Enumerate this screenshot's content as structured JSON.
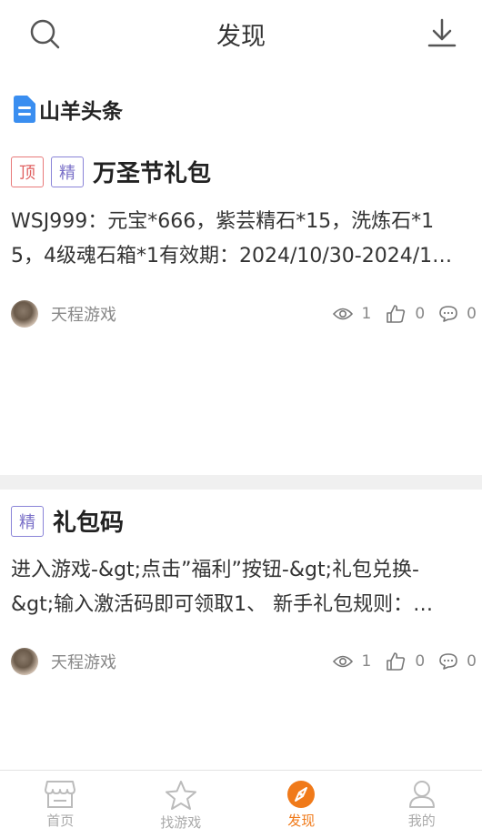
{
  "header": {
    "title": "发现",
    "search_icon": "search-icon",
    "download_icon": "download-icon"
  },
  "section": {
    "label": "山羊头条",
    "icon": "document-icon",
    "icon_color": "#3a8ef0"
  },
  "posts": [
    {
      "tags": [
        "顶",
        "精"
      ],
      "title": "万圣节礼包",
      "desc_line1": "WSJ999：元宝*666，紫芸精石*15，洗炼石*1",
      "desc_line2": "5，4级魂石箱*1有效期：2024/10/30-2024/1…",
      "author": "天程游戏",
      "views": "1",
      "likes": "0",
      "comments": "0"
    },
    {
      "tags": [
        "精"
      ],
      "title": "礼包码",
      "desc_line1": "进入游戏-&gt;点击”福利”按钮-&gt;礼包兑换-",
      "desc_line2": "&gt;输入激活码即可领取1、 新手礼包规则：…",
      "author": "天程游戏",
      "views": "1",
      "likes": "0",
      "comments": "0"
    }
  ],
  "tabbar": {
    "items": [
      {
        "label": "首页",
        "icon": "store-icon"
      },
      {
        "label": "找游戏",
        "icon": "star-icon"
      },
      {
        "label": "发现",
        "icon": "compass-icon",
        "active": true
      },
      {
        "label": "我的",
        "icon": "user-icon"
      }
    ],
    "accent": "#f07a1a"
  }
}
